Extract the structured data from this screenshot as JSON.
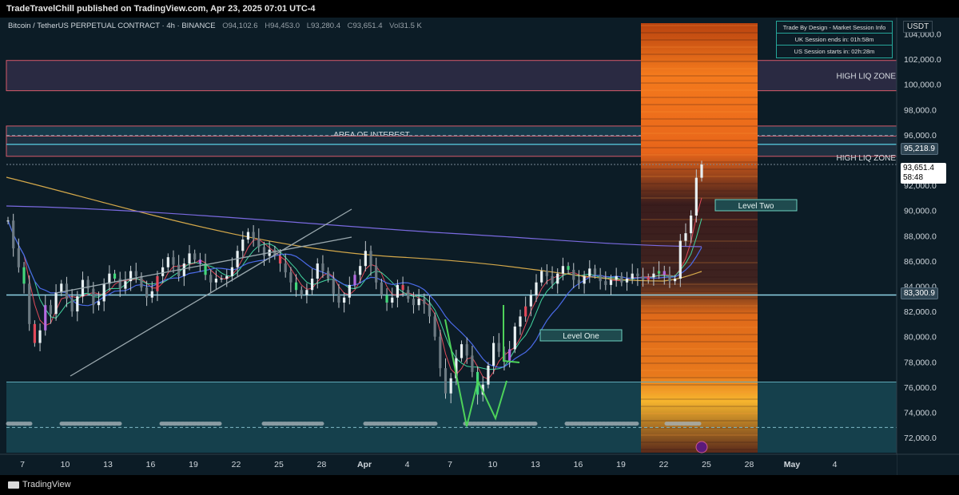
{
  "header": {
    "published_text": "TradeTravelChill published on TradingView.com, Apr 23, 2025 07:01 UTC-4"
  },
  "legend": {
    "symbol": "Bitcoin / TetherUS PERPETUAL CONTRACT · 4h · BINANCE",
    "o_label": "O",
    "o_value": "94,102.6",
    "h_label": "H",
    "h_value": "94,453.0",
    "l_label": "L",
    "l_value": "93,280.4",
    "c_label": "C",
    "c_value": "93,651.4",
    "vol_label": "Vol",
    "vol_value": "31.5 K"
  },
  "session_box": {
    "title": "Trade By Design - Market Session Info",
    "uk": "UK Session ends in: 01h:58m",
    "us": "US Session starts in: 02h:28m"
  },
  "footer": {
    "brand": "TradingView"
  },
  "chart_data": {
    "type": "candlestick",
    "currency": "USDT",
    "y_ticks": [
      "72,000.0",
      "74,000.0",
      "76,000.0",
      "78,000.0",
      "80,000.0",
      "82,000.0",
      "84,000.0",
      "86,000.0",
      "88,000.0",
      "90,000.0",
      "92,000.0",
      "96,000.0",
      "98,000.0",
      "100,000.0",
      "102,000.0",
      "104,000.0"
    ],
    "ylim": [
      70800,
      105300
    ],
    "x_ticks": [
      "7",
      "10",
      "13",
      "16",
      "19",
      "22",
      "25",
      "28",
      "Apr",
      "4",
      "7",
      "10",
      "13",
      "16",
      "19",
      "22",
      "25",
      "28",
      "May",
      "4"
    ],
    "current_price": "93,651.4",
    "countdown": "58:48",
    "price_labels": [
      "95,218.9",
      "83,300.9"
    ],
    "zones": [
      {
        "label": "HIGH LIQ ZONE",
        "from": 99500,
        "to": 101900
      },
      {
        "label": "AREA OF INTEREST",
        "from": 95200,
        "to": 96700
      },
      {
        "label": "HIGH LIQ ZONE",
        "from": 94300,
        "to": 95900
      }
    ],
    "boxes": [
      {
        "label": "Level One"
      },
      {
        "label": "Level Two"
      }
    ],
    "horizontal_levels": [
      83300.9,
      76400
    ],
    "series_close": [
      89200,
      87000,
      85500,
      84200,
      81000,
      79500,
      80500,
      82500,
      81800,
      83500,
      84200,
      83000,
      82000,
      83200,
      84500,
      83800,
      82500,
      82800,
      84200,
      85000,
      84600,
      83800,
      84400,
      85200,
      84800,
      83900,
      83100,
      83600,
      84800,
      85500,
      86300,
      85700,
      84800,
      85800,
      86600,
      86100,
      85800,
      84900,
      84300,
      84600,
      84600,
      84800,
      85500,
      86800,
      87700,
      88300,
      87800,
      87100,
      86400,
      86900,
      86400,
      85800,
      85100,
      84300,
      83700,
      83300,
      83700,
      84600,
      85800,
      85200,
      84600,
      83400,
      82700,
      83100,
      84100,
      84900,
      85600,
      86800,
      85600,
      84300,
      83300,
      82700,
      83100,
      84100,
      83700,
      83000,
      82500,
      83000,
      82600,
      81600,
      80000,
      77500,
      75500,
      76700,
      78300,
      79400,
      78500,
      77200,
      75400,
      76200,
      77700,
      79500,
      78800,
      78100,
      79000,
      80800,
      81600,
      82400,
      83300,
      84300,
      85200,
      84800,
      84200,
      85000,
      85600,
      85300,
      84500,
      84200,
      84800,
      85400,
      84900,
      84400,
      84100,
      84500,
      84800,
      84300,
      84600,
      85000,
      84800,
      84500,
      84700,
      85000,
      85200,
      84900,
      84400,
      84600,
      87600,
      88200,
      89600,
      92600,
      93651
    ]
  }
}
